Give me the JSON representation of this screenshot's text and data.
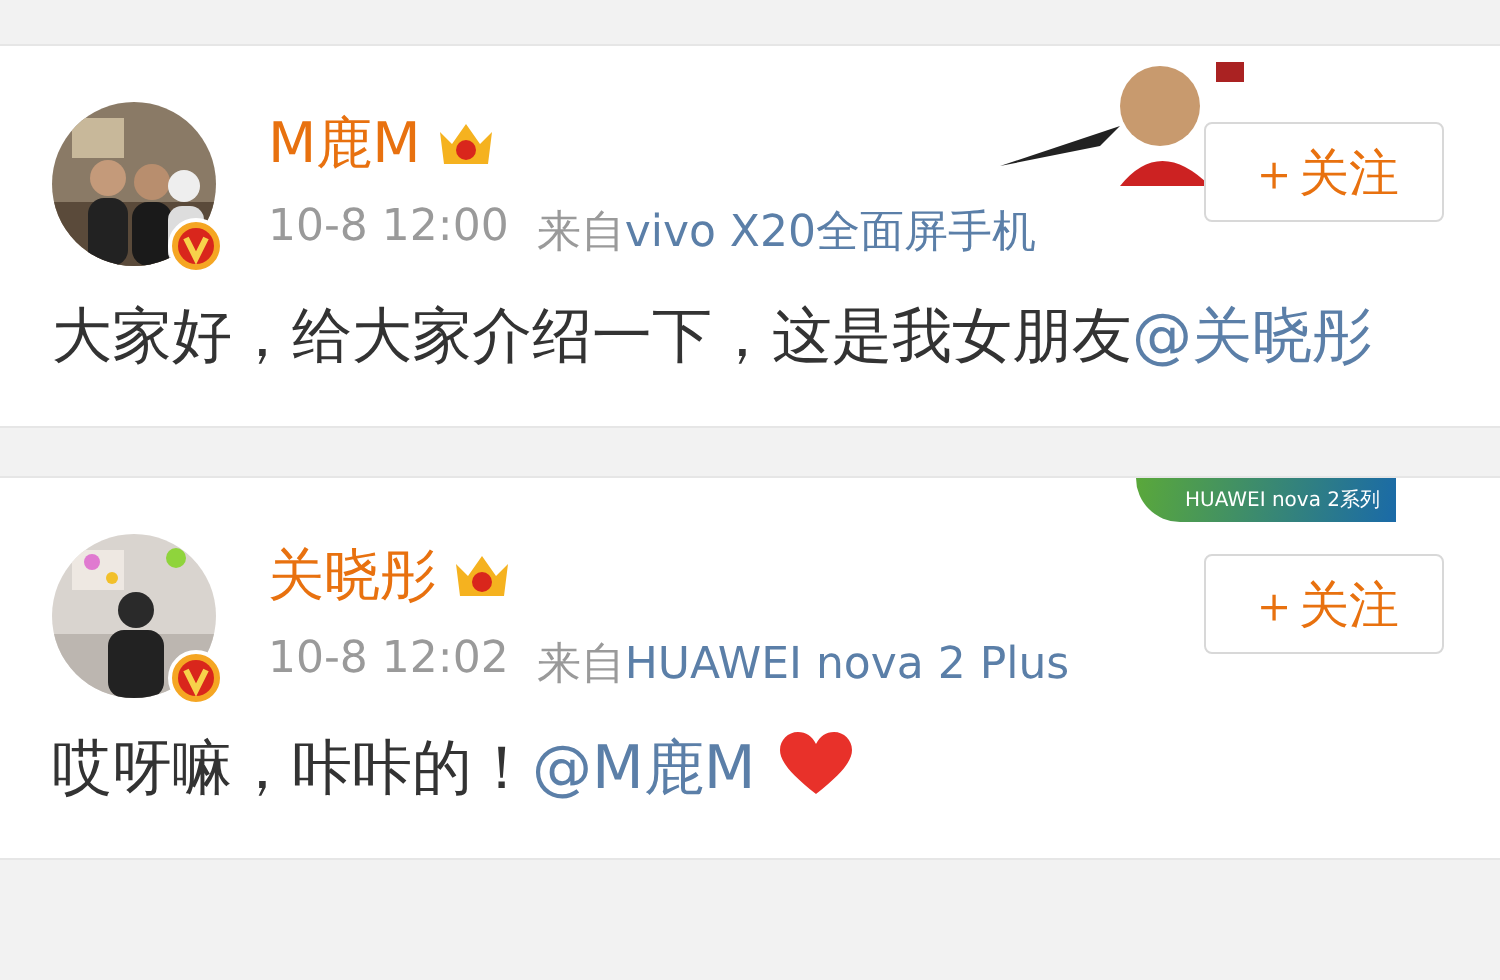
{
  "posts": [
    {
      "author": "M鹿M",
      "time": "10-8 12:00",
      "source_prefix": "来自",
      "source": "vivo X20全面屏手机",
      "follow": "＋关注",
      "skin": {
        "kind": "picture"
      },
      "body": [
        {
          "kind": "text",
          "text": "大家好，给大家介绍一下，这是我女朋友"
        },
        {
          "kind": "mention",
          "text": "@关晓彤"
        }
      ]
    },
    {
      "author": "关晓彤",
      "time": "10-8 12:02",
      "source_prefix": "来自",
      "source": "HUAWEI nova 2 Plus",
      "follow": "＋关注",
      "skin": {
        "kind": "banner",
        "text": "HUAWEI nova 2系列"
      },
      "body": [
        {
          "kind": "text",
          "text": "哎呀嘛，咔咔的！"
        },
        {
          "kind": "mention",
          "text": "@M鹿M"
        },
        {
          "kind": "heart"
        }
      ]
    }
  ]
}
